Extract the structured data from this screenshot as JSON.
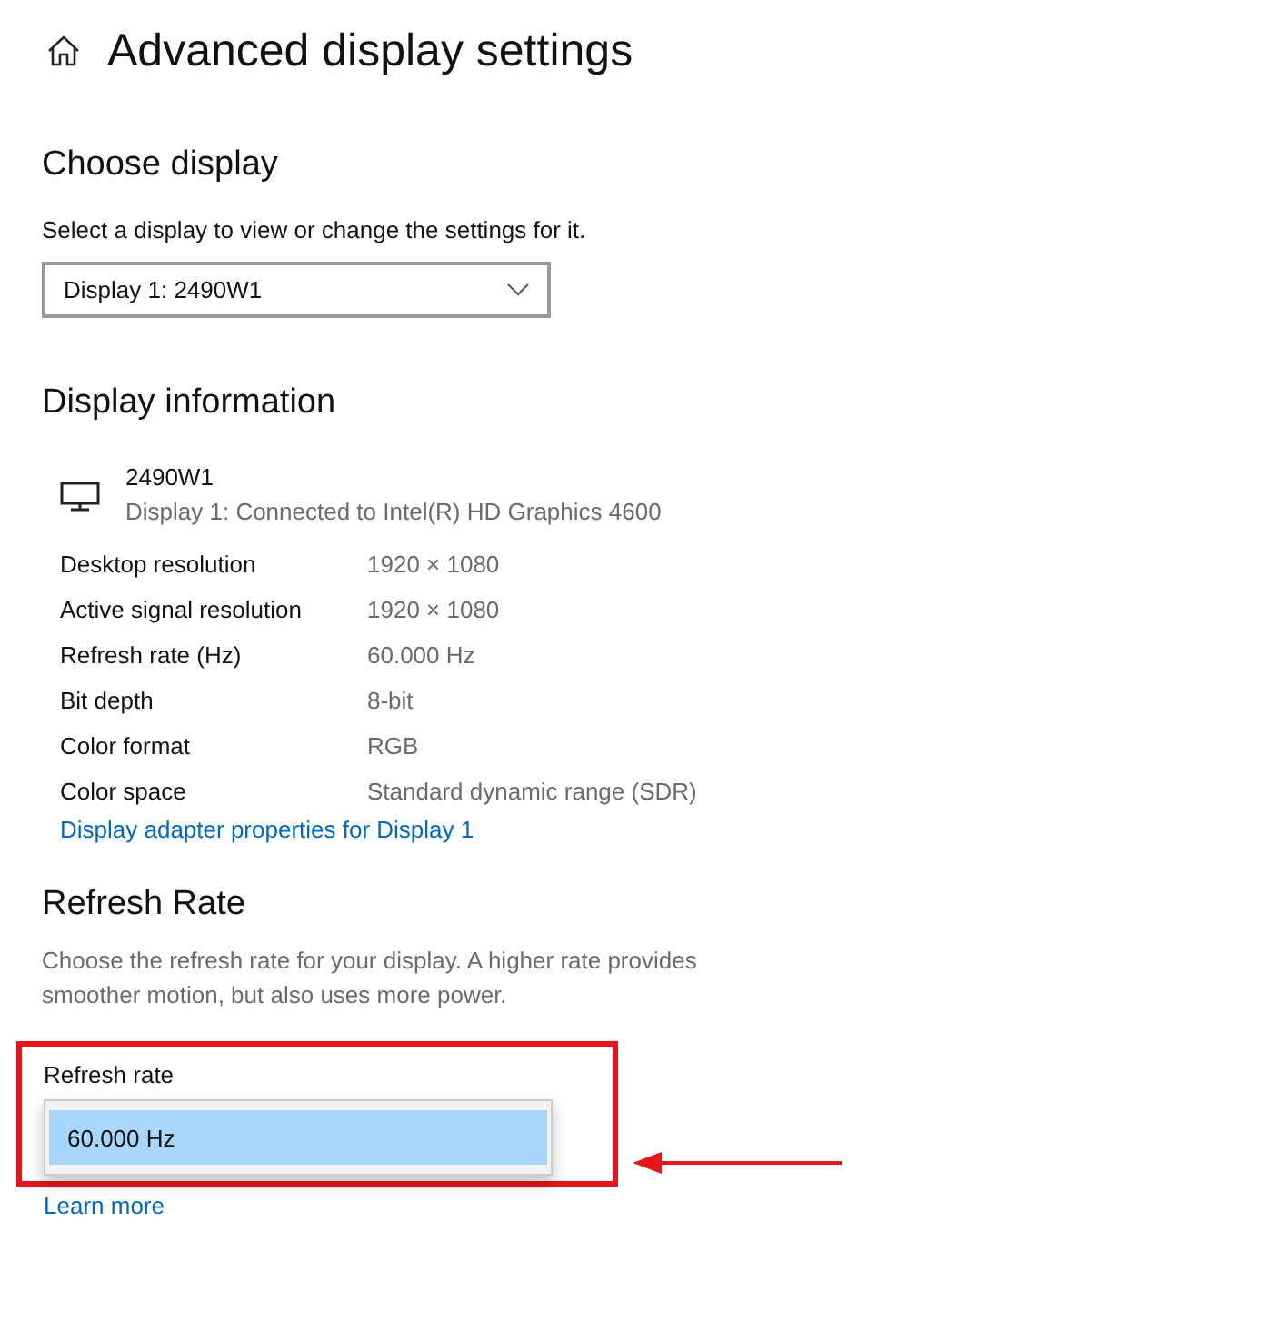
{
  "page": {
    "title": "Advanced display settings"
  },
  "choose_display": {
    "heading": "Choose display",
    "description": "Select a display to view or change the settings for it.",
    "dropdown": {
      "value": "Display 1: 2490W1"
    }
  },
  "display_information": {
    "heading": "Display information",
    "monitor": {
      "name": "2490W1",
      "detail": "Display 1: Connected to Intel(R) HD Graphics 4600"
    },
    "rows": [
      {
        "label": "Desktop resolution",
        "value": "1920 × 1080"
      },
      {
        "label": "Active signal resolution",
        "value": "1920 × 1080"
      },
      {
        "label": "Refresh rate (Hz)",
        "value": "60.000 Hz"
      },
      {
        "label": "Bit depth",
        "value": "8-bit"
      },
      {
        "label": "Color format",
        "value": "RGB"
      },
      {
        "label": "Color space",
        "value": "Standard dynamic range (SDR)"
      }
    ],
    "link": "Display adapter properties for Display 1"
  },
  "refresh_rate": {
    "heading": "Refresh Rate",
    "description": "Choose the refresh rate for your display. A higher rate provides smoother motion, but also uses more power.",
    "label": "Refresh rate",
    "options": [
      {
        "label": "60.000 Hz",
        "selected": true
      }
    ],
    "link": "Learn more"
  }
}
